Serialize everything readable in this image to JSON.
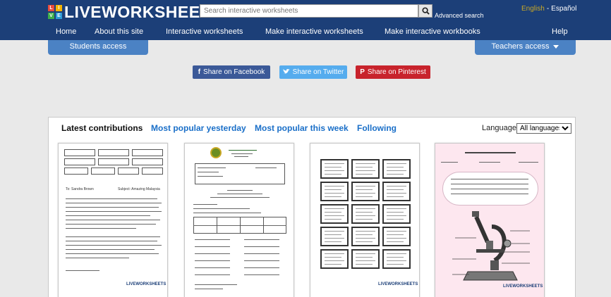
{
  "header": {
    "logo_text": "LIVEWORKSHEETS",
    "logo_letters": [
      "L",
      "I",
      "V",
      "E"
    ],
    "search_placeholder": "Search interactive worksheets",
    "advanced_search": "Advanced search",
    "lang_english": "English",
    "lang_separator": "-",
    "lang_spanish": "Español"
  },
  "nav": {
    "home": "Home",
    "about": "About this site",
    "interactive": "Interactive worksheets",
    "make_worksheets": "Make interactive worksheets",
    "make_workbooks": "Make interactive workbooks",
    "help": "Help"
  },
  "tabs": {
    "students": "Students access",
    "teachers": "Teachers access"
  },
  "share": {
    "facebook": "Share on Facebook",
    "twitter": "Share on Twitter",
    "pinterest": "Share on Pinterest"
  },
  "contributions": {
    "latest": "Latest contributions",
    "popular_yesterday": "Most popular yesterday",
    "popular_week": "Most popular this week",
    "following": "Following",
    "language_label": "Language:",
    "language_selected": "All languages"
  },
  "thumbnails": {
    "t1": {
      "greeting": "To: Sandra Brown",
      "subject": "Subject: Amazing Malaysia",
      "brand": "LIVEWORKSHEETS"
    },
    "t3": {
      "brand": "LIVEWORKSHEETS"
    },
    "t4": {
      "brand": "LIVEWORKSHEETS"
    }
  },
  "colors": {
    "header_bg": "#1c3f78",
    "tab_bg": "#4b82c4",
    "link_blue": "#1a6fc8",
    "facebook": "#3b5998",
    "twitter": "#55acee",
    "pinterest": "#c8232c",
    "lang_gold": "#c9a825"
  }
}
